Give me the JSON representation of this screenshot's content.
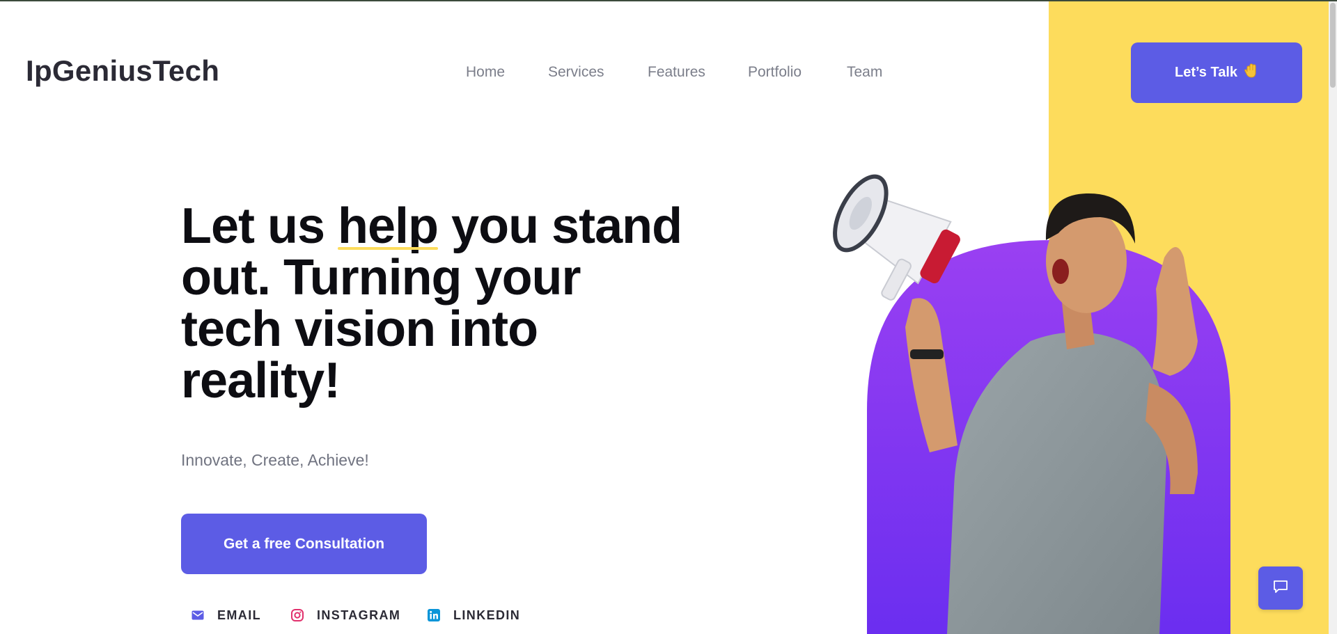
{
  "header": {
    "logo": "IpGeniusTech",
    "nav": [
      {
        "label": "Home"
      },
      {
        "label": "Services"
      },
      {
        "label": "Features"
      },
      {
        "label": "Portfolio"
      },
      {
        "label": "Team"
      }
    ],
    "cta_label": "Let’s Talk",
    "cta_icon": "waving-hand-icon"
  },
  "hero": {
    "title_lines": [
      [
        "Let us ",
        "help",
        " you stand"
      ],
      [
        "out. Turning your"
      ],
      [
        "tech vision into"
      ],
      [
        "reality!"
      ]
    ],
    "subtitle": "Innovate, Create, Achieve!",
    "cta_label": "Get a free Consultation",
    "illustration": "man-shouting-megaphone"
  },
  "social": [
    {
      "label": "EMAIL",
      "icon": "mail-icon",
      "color": "#5c5ce5"
    },
    {
      "label": "INSTAGRAM",
      "icon": "instagram-icon",
      "color": "#e1306c"
    },
    {
      "label": "LINKEDIN",
      "icon": "linkedin-icon",
      "color": "#0a66c2"
    }
  ],
  "chat_widget": {
    "icon": "chat-bubble-icon"
  },
  "colors": {
    "accent": "#5c5ce5",
    "highlight": "#fddc5c",
    "purple_shape": "#8a3ff0"
  }
}
